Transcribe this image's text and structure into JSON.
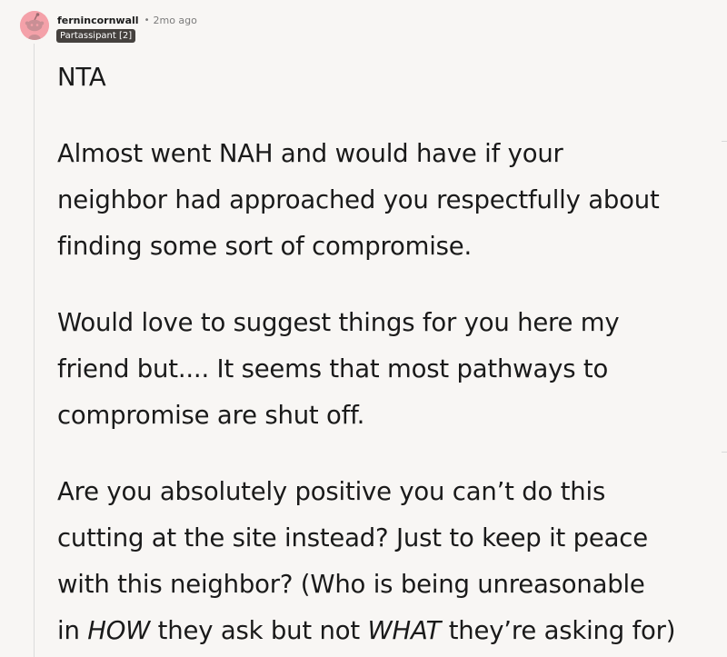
{
  "comment": {
    "username": "fernincornwall",
    "separator": "•",
    "timestamp": "2mo ago",
    "flair": "Partassipant [2]",
    "paragraphs": {
      "p1": {
        "l1": "NTA"
      },
      "p2": {
        "l1": "Almost went NAH and would have if your",
        "l2": "neighbor had approached you respectfully about",
        "l3": "finding some sort of compromise."
      },
      "p3": {
        "l1": "Would love to suggest things for you here my",
        "l2": "friend but.... It seems that most pathways to",
        "l3": "compromise are shut off."
      },
      "p4": {
        "l1": "Are you absolutely positive you can’t do this",
        "l2": "cutting at the site instead? Just to keep it peace",
        "l3": "with this neighbor? (Who is being unreasonable",
        "l4_pre": "in ",
        "l4_em1": "HOW",
        "l4_mid": " they ask but not ",
        "l4_em2": "WHAT",
        "l4_post": " they’re asking for)"
      }
    }
  },
  "avatar": {
    "icon": "snoo-avatar-icon",
    "background_color": "#f4a1a9"
  },
  "colors": {
    "page_background": "#f8f6f4",
    "flair_background": "#45413e",
    "text": "#1a1a1a",
    "muted_text": "#7c7c7c"
  }
}
